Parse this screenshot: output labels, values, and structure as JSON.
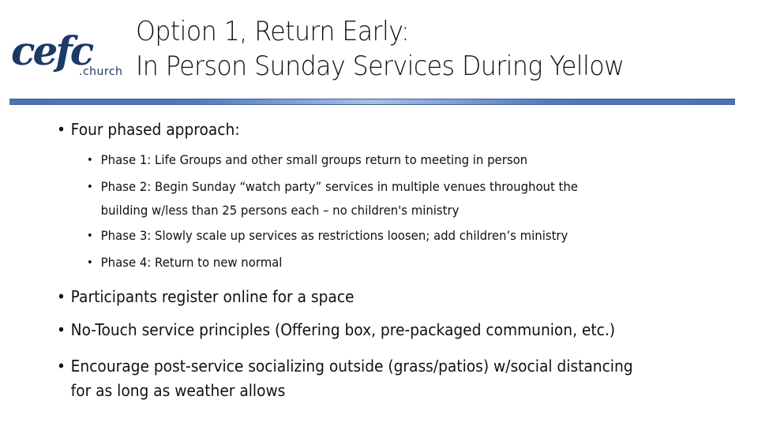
{
  "logo": {
    "main": "cefc",
    "sub": ".church",
    "color": "#1b3a66"
  },
  "title": {
    "line1": "Option 1, Return Early:",
    "line2": "In Person Sunday Services During Yellow"
  },
  "divider": {
    "color_edge": "#4a72b8",
    "color_center": "#a8c0e4"
  },
  "bullets": [
    {
      "text": "Four phased approach:",
      "sub": [
        {
          "lines": [
            "Phase 1: Life Groups and other small groups return to meeting in person"
          ]
        },
        {
          "lines": [
            "Phase 2: Begin Sunday “watch party” services in multiple venues throughout the",
            "building w/less than 25 persons each – no children's ministry"
          ]
        },
        {
          "lines": [
            "Phase 3: Slowly scale up services as restrictions loosen; add children’s ministry"
          ]
        },
        {
          "lines": [
            "Phase 4: Return to new normal"
          ]
        }
      ]
    },
    {
      "text": "Participants register online for a space"
    },
    {
      "text": "No-Touch service principles (Offering box, pre-packaged communion, etc.)"
    },
    {
      "lines": [
        "Encourage post-service socializing outside (grass/patios) w/social distancing",
        "for as long as weather allows"
      ]
    }
  ],
  "bullet_glyph": "•"
}
